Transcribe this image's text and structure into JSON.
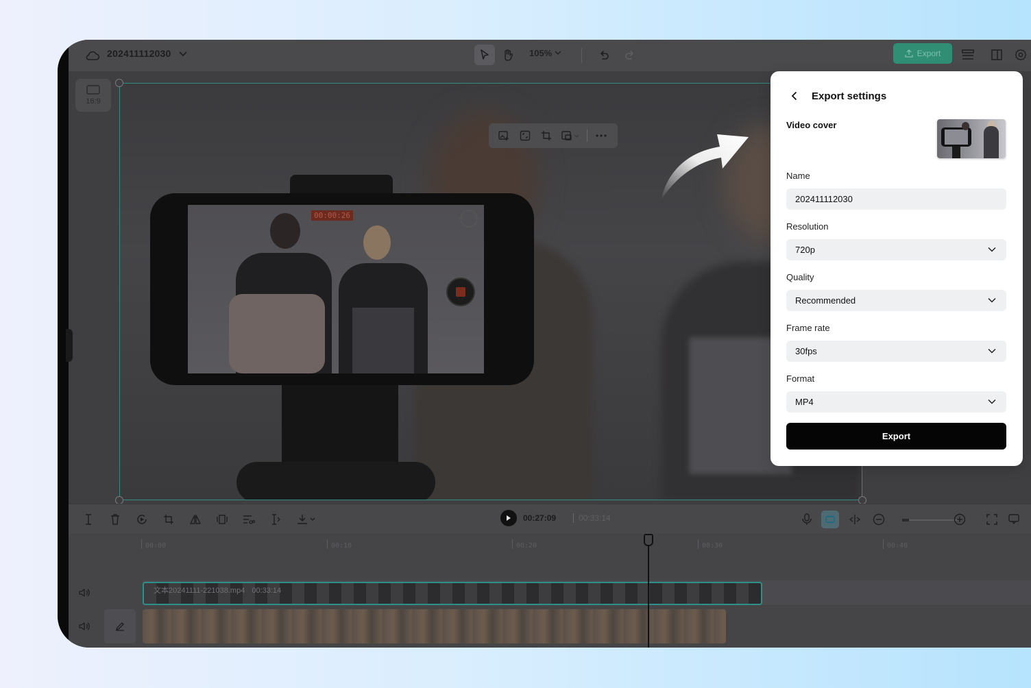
{
  "project": {
    "title": "202411112030"
  },
  "toolbar": {
    "zoom": "105%"
  },
  "top_export": {
    "label": "Export"
  },
  "ratio": {
    "label": "16:9"
  },
  "phone_screen": {
    "rec_time": "00:00:26"
  },
  "player": {
    "current_time": "00:27:09",
    "total_time": "00:33:14"
  },
  "ruler": {
    "labels": [
      "00:00",
      "00:10",
      "00:20",
      "00:30",
      "00:40"
    ]
  },
  "clip": {
    "filename": "文本20241111-221038.mp4",
    "duration": "00:33:14"
  },
  "export_panel": {
    "title": "Export settings",
    "video_cover_label": "Video cover",
    "name_label": "Name",
    "name_value": "202411112030",
    "resolution_label": "Resolution",
    "resolution_value": "720p",
    "quality_label": "Quality",
    "quality_value": "Recommended",
    "framerate_label": "Frame rate",
    "framerate_value": "30fps",
    "format_label": "Format",
    "format_value": "MP4",
    "export_button": "Export"
  },
  "colors": {
    "accent_teal": "#2d9189",
    "export_black": "#050505",
    "panel_bg": "#ffffff",
    "field_bg": "#eef0f2"
  }
}
